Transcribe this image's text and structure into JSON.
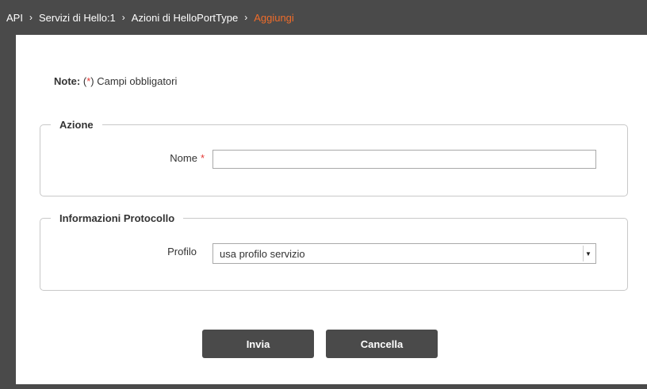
{
  "breadcrumb": {
    "items": [
      "API",
      "Servizi di Hello:1",
      "Azioni di HelloPortType"
    ],
    "current": "Aggiungi",
    "separator": "›"
  },
  "note": {
    "prefix": "Note:",
    "open": "(",
    "asterisk": "*",
    "close": ")",
    "text": "Campi obbligatori"
  },
  "azione": {
    "legend": "Azione",
    "nome_label": "Nome",
    "required_mark": "*",
    "nome_value": ""
  },
  "protocollo": {
    "legend": "Informazioni Protocollo",
    "profilo_label": "Profilo",
    "profilo_value": "usa profilo servizio"
  },
  "buttons": {
    "invia": "Invia",
    "cancella": "Cancella"
  },
  "colors": {
    "header_bg": "#4a4a4a",
    "accent": "#ef6c2a",
    "required": "#e53935"
  }
}
